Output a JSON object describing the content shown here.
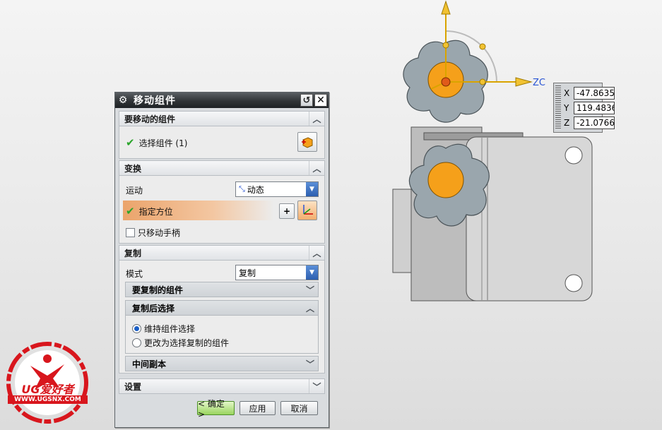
{
  "dialog": {
    "title": "移动组件",
    "sections": {
      "components": {
        "title": "要移动的组件",
        "select_label": "选择组件 (1)"
      },
      "transform": {
        "title": "变换",
        "motion_label": "运动",
        "motion_value": "动态",
        "orient_label": "指定方位",
        "handles_only_label": "只移动手柄"
      },
      "copy": {
        "title": "复制",
        "mode_label": "模式",
        "mode_value": "复制",
        "components_to_copy": "要复制的组件",
        "after_copy": "复制后选择",
        "radio_keep": "维持组件选择",
        "radio_change": "更改为选择复制的组件",
        "intermediate": "中间副本"
      },
      "settings": {
        "title": "设置"
      }
    },
    "buttons": {
      "ok": "< 确定 >",
      "apply": "应用",
      "cancel": "取消"
    }
  },
  "viewport": {
    "axis_label": "ZC",
    "coords": {
      "x_label": "X",
      "x": "-47.8635",
      "y_label": "Y",
      "y": "119.4836",
      "z_label": "Z",
      "z": "-21.0766"
    }
  },
  "logo": {
    "text": "UG爱好者",
    "url": "WWW.UGSNX.COM"
  },
  "colors": {
    "accent_orange": "#f5a01a",
    "knob": "#9aa6ad",
    "check_green": "#2aa52a"
  }
}
